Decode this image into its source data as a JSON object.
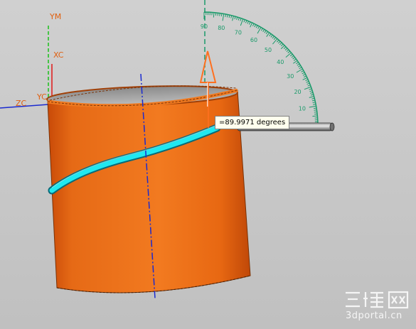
{
  "viewport": {
    "axes": {
      "ym_label": "YM",
      "xc_label": "XC",
      "zc_label": "ZC",
      "yc_label": "YC"
    },
    "protractor": {
      "tick_labels": [
        "90",
        "80",
        "70",
        "60",
        "50",
        "40",
        "30",
        "20",
        "10"
      ],
      "color": "#1a9a6a"
    },
    "angle_readout": {
      "value_text": "=89.9971 degrees"
    },
    "colors": {
      "body": "#f06a10",
      "helix_groove": "#20e8f0",
      "axis": "#1a2ad0",
      "background": "#c4c4c4"
    }
  },
  "watermark": {
    "logo": "三维网",
    "url": "3dportal.cn"
  }
}
